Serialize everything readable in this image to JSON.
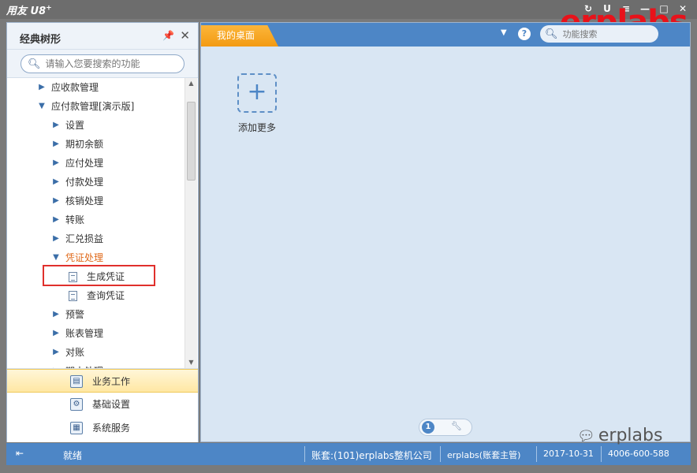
{
  "window": {
    "app_title": "用友 U8",
    "app_title_sup": "+"
  },
  "left_panel": {
    "title": "经典树形",
    "search_placeholder": "请输入您要搜索的功能",
    "tree": [
      {
        "label": "应收款管理",
        "level": 1,
        "expanded": false
      },
      {
        "label": "应付款管理[演示版]",
        "level": 1,
        "expanded": true
      },
      {
        "label": "设置",
        "level": 2,
        "expanded": false
      },
      {
        "label": "期初余额",
        "level": 2,
        "expanded": false
      },
      {
        "label": "应付处理",
        "level": 2,
        "expanded": false
      },
      {
        "label": "付款处理",
        "level": 2,
        "expanded": false
      },
      {
        "label": "核销处理",
        "level": 2,
        "expanded": false
      },
      {
        "label": "转账",
        "level": 2,
        "expanded": false
      },
      {
        "label": "汇兑损益",
        "level": 2,
        "expanded": false
      },
      {
        "label": "凭证处理",
        "level": 2,
        "expanded": true,
        "active": true
      },
      {
        "label": "生成凭证",
        "level": 3,
        "leaf": true,
        "highlighted": true
      },
      {
        "label": "查询凭证",
        "level": 3,
        "leaf": true
      },
      {
        "label": "预警",
        "level": 2,
        "expanded": false
      },
      {
        "label": "账表管理",
        "level": 2,
        "expanded": false
      },
      {
        "label": "对账",
        "level": 2,
        "expanded": false
      },
      {
        "label": "期末处理",
        "level": 2,
        "expanded": false
      }
    ],
    "modules": [
      {
        "label": "业务工作",
        "active": true
      },
      {
        "label": "基础设置",
        "active": false
      },
      {
        "label": "系统服务",
        "active": false
      }
    ]
  },
  "workspace": {
    "tab_label": "我的桌面",
    "search_placeholder": "功能搜索",
    "add_more_label": "添加更多",
    "page_number": "1"
  },
  "watermark": {
    "logo_text": "erplabs",
    "wechat_text": "erplabs"
  },
  "status_bar": {
    "ready": "就绪",
    "account": "账套:(101)erplabs整机公司",
    "user": "erplabs(账套主管)",
    "date": "2017-10-31",
    "phone": "4006-600-588"
  },
  "colors": {
    "accent": "#4d86c6",
    "tab": "#f39b13",
    "highlight_border": "#e0302c",
    "active_text": "#e06a1b"
  }
}
